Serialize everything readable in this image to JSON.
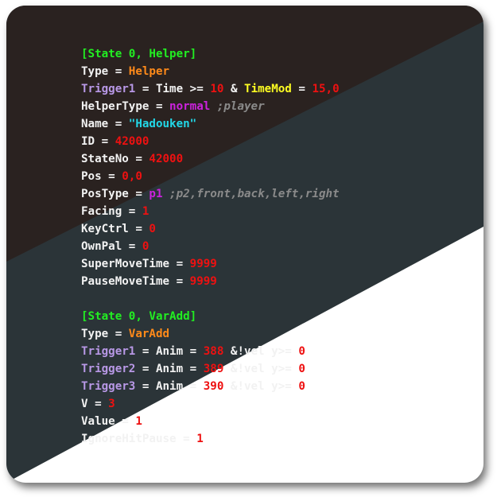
{
  "colors": {
    "panel_dark": "#2a2220",
    "panel_slate": "#2b3438",
    "panel_light": "#ffffff",
    "section": "#22ee22",
    "param": "#b898e6",
    "keyword": "#ff8a1a",
    "number": "#ee1111",
    "const": "#cc22dd",
    "string": "#22d8e8",
    "trigger": "#ffff22",
    "comment": "#8a8a8a",
    "plain": "#f2f2f2"
  },
  "code_lines": [
    [
      {
        "text": "[State 0, Helper]",
        "cls": "section"
      }
    ],
    [
      {
        "text": "Type",
        "cls": "plain"
      },
      {
        "text": " = ",
        "cls": "plain"
      },
      {
        "text": "Helper",
        "cls": "keyword"
      }
    ],
    [
      {
        "text": "Trigger1",
        "cls": "param"
      },
      {
        "text": " = Time >= ",
        "cls": "plain"
      },
      {
        "text": "10",
        "cls": "number"
      },
      {
        "text": " & ",
        "cls": "plain"
      },
      {
        "text": "TimeMod",
        "cls": "trigger"
      },
      {
        "text": " = ",
        "cls": "plain"
      },
      {
        "text": "15,0",
        "cls": "number"
      }
    ],
    [
      {
        "text": "HelperType = ",
        "cls": "plain"
      },
      {
        "text": "normal",
        "cls": "const"
      },
      {
        "text": " ;player",
        "cls": "comment"
      }
    ],
    [
      {
        "text": "Name = ",
        "cls": "plain"
      },
      {
        "text": "\"Hadouken\"",
        "cls": "string"
      }
    ],
    [
      {
        "text": "ID = ",
        "cls": "plain"
      },
      {
        "text": "42000",
        "cls": "number"
      }
    ],
    [
      {
        "text": "StateNo = ",
        "cls": "plain"
      },
      {
        "text": "42000",
        "cls": "number"
      }
    ],
    [
      {
        "text": "Pos = ",
        "cls": "plain"
      },
      {
        "text": "0,0",
        "cls": "number"
      }
    ],
    [
      {
        "text": "PosType = ",
        "cls": "plain"
      },
      {
        "text": "p1",
        "cls": "const"
      },
      {
        "text": " ;p2,front,back,left,right",
        "cls": "comment"
      }
    ],
    [
      {
        "text": "Facing = ",
        "cls": "plain"
      },
      {
        "text": "1",
        "cls": "number"
      }
    ],
    [
      {
        "text": "KeyCtrl = ",
        "cls": "plain"
      },
      {
        "text": "0",
        "cls": "number"
      }
    ],
    [
      {
        "text": "OwnPal = ",
        "cls": "plain"
      },
      {
        "text": "0",
        "cls": "number"
      }
    ],
    [
      {
        "text": "SuperMoveTime = ",
        "cls": "plain"
      },
      {
        "text": "9999",
        "cls": "number"
      }
    ],
    [
      {
        "text": "PauseMoveTime = ",
        "cls": "plain"
      },
      {
        "text": "9999",
        "cls": "number"
      }
    ],
    [],
    [
      {
        "text": "[State 0, VarAdd]",
        "cls": "section"
      }
    ],
    [
      {
        "text": "Type = ",
        "cls": "plain"
      },
      {
        "text": "VarAdd",
        "cls": "keyword"
      }
    ],
    [
      {
        "text": "Trigger1",
        "cls": "param"
      },
      {
        "text": " = Anim = ",
        "cls": "plain"
      },
      {
        "text": "388",
        "cls": "number"
      },
      {
        "text": " &!vel y>= ",
        "cls": "plain"
      },
      {
        "text": "0",
        "cls": "number"
      }
    ],
    [
      {
        "text": "Trigger2",
        "cls": "param"
      },
      {
        "text": " = Anim = ",
        "cls": "plain"
      },
      {
        "text": "389",
        "cls": "number"
      },
      {
        "text": " &!vel y>= ",
        "cls": "plain"
      },
      {
        "text": "0",
        "cls": "number"
      }
    ],
    [
      {
        "text": "Trigger3",
        "cls": "param"
      },
      {
        "text": " = Anim = ",
        "cls": "plain"
      },
      {
        "text": "390",
        "cls": "number"
      },
      {
        "text": " &!vel y>= ",
        "cls": "plain"
      },
      {
        "text": "0",
        "cls": "number"
      }
    ],
    [
      {
        "text": "V = ",
        "cls": "plain"
      },
      {
        "text": "3",
        "cls": "number"
      }
    ],
    [
      {
        "text": "Value = ",
        "cls": "plain"
      },
      {
        "text": "1",
        "cls": "number"
      }
    ],
    [
      {
        "text": "IgnoreHitPause = ",
        "cls": "plain"
      },
      {
        "text": "1",
        "cls": "number"
      }
    ]
  ]
}
